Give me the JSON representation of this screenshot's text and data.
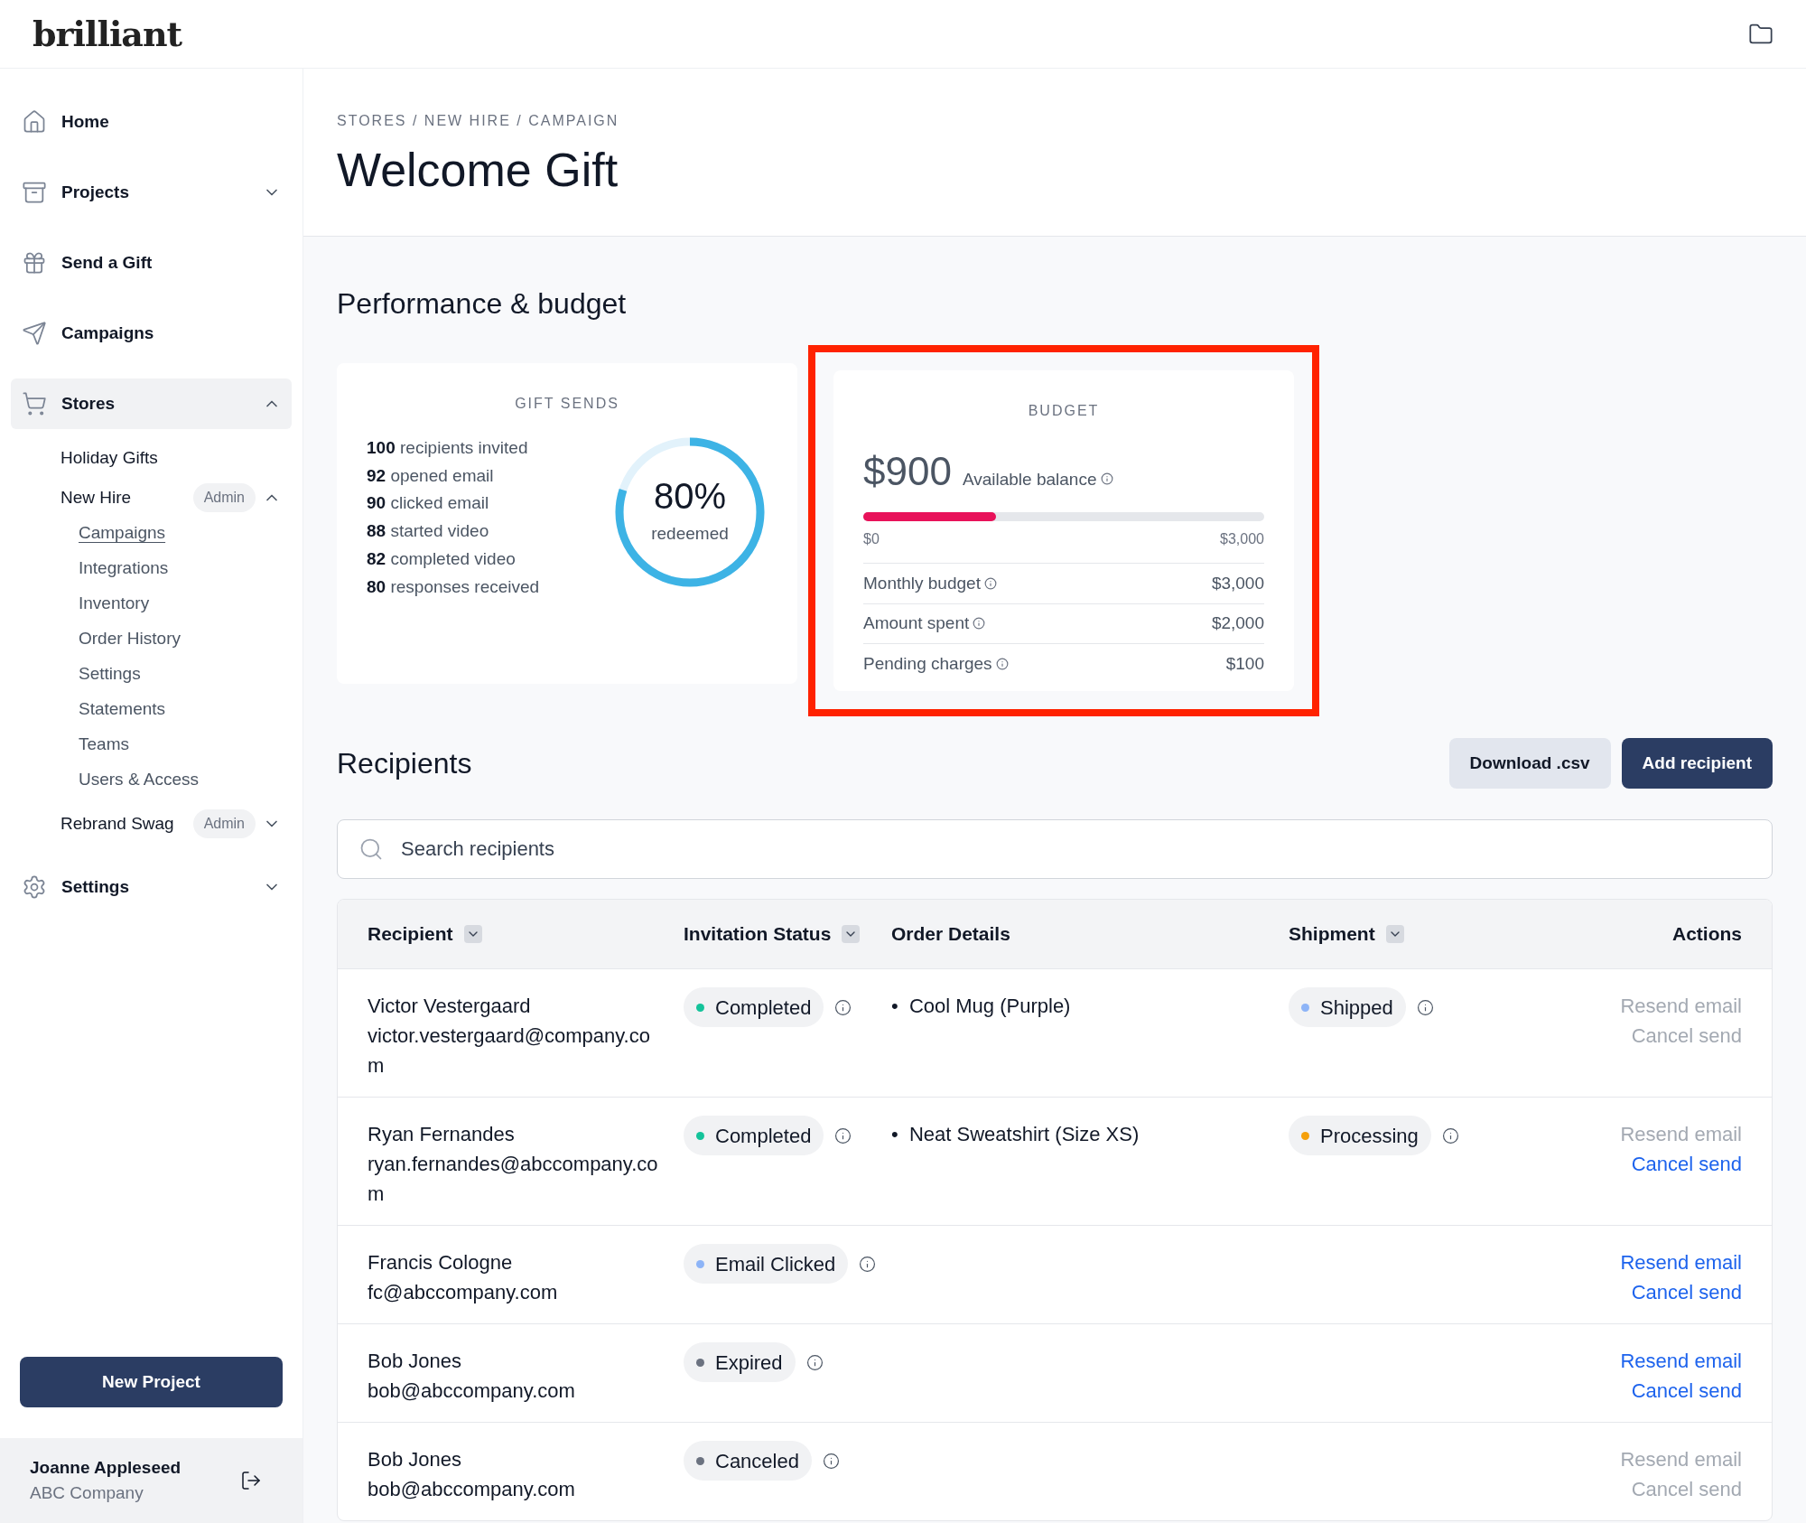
{
  "header": {
    "logo": "brilliant"
  },
  "sidebar": {
    "items": [
      {
        "label": "Home",
        "selected": false
      },
      {
        "label": "Projects",
        "selected": false,
        "expanded": false
      },
      {
        "label": "Send a Gift",
        "selected": false
      },
      {
        "label": "Campaigns",
        "selected": false
      },
      {
        "label": "Stores",
        "selected": true,
        "expanded": true,
        "children": [
          {
            "label": "Holiday Gifts"
          },
          {
            "label": "New Hire",
            "badge": "Admin",
            "expanded": true,
            "children": [
              {
                "label": "Campaigns",
                "selected": true
              },
              {
                "label": "Integrations",
                "selected": false
              },
              {
                "label": "Inventory",
                "selected": false
              },
              {
                "label": "Order History",
                "selected": false
              },
              {
                "label": "Settings",
                "selected": false
              },
              {
                "label": "Statements",
                "selected": false
              },
              {
                "label": "Teams",
                "selected": false
              },
              {
                "label": "Users & Access",
                "selected": false
              }
            ]
          },
          {
            "label": "Rebrand Swag",
            "badge": "Admin",
            "expanded": false
          }
        ]
      },
      {
        "label": "Settings",
        "selected": false,
        "expanded": false
      }
    ],
    "new_project_button": "New Project",
    "user": {
      "name": "Joanne Appleseed",
      "company": "ABC Company"
    }
  },
  "breadcrumb": "STORES / NEW HIRE / CAMPAIGN",
  "title": "Welcome Gift",
  "performance": {
    "heading": "Performance & budget",
    "gift_sends": {
      "title": "GIFT SENDS",
      "stats": [
        {
          "count": "100",
          "label": "recipients invited"
        },
        {
          "count": "92",
          "label": "opened email"
        },
        {
          "count": "90",
          "label": "clicked email"
        },
        {
          "count": "88",
          "label": "started video"
        },
        {
          "count": "82",
          "label": "completed video"
        },
        {
          "count": "80",
          "label": "responses received"
        }
      ],
      "ring": {
        "level": 0.8,
        "value": "80%",
        "caption": "redeemed"
      }
    },
    "budget": {
      "highlighted": true,
      "title": "BUDGET",
      "amount": "$900",
      "amount_label": "Available balance",
      "level": 0.33,
      "min_label": "$0",
      "max_label": "$3,000",
      "rows": [
        {
          "label": "Monthly budget",
          "value": "$3,000"
        },
        {
          "label": "Amount spent",
          "value": "$2,000"
        },
        {
          "label": "Pending charges",
          "value": "$100"
        }
      ]
    }
  },
  "recipients": {
    "heading": "Recipients",
    "buttons": [
      {
        "kind": "secondary",
        "label": "Download .csv"
      },
      {
        "kind": "primary",
        "label": "Add recipient"
      }
    ],
    "search": {
      "placeholder": "Search recipients"
    },
    "columns": [
      {
        "label": "Recipient",
        "sortable": true
      },
      {
        "label": "Invitation Status",
        "sortable": true
      },
      {
        "label": "Order Details",
        "sortable": false
      },
      {
        "label": "Shipment",
        "sortable": true
      },
      {
        "label": "Actions",
        "sortable": false
      }
    ],
    "rows": [
      {
        "name": "Victor Vestergaard",
        "email": "victor.vestergaard@company.com",
        "status": {
          "label": "Completed",
          "color": "#14c39a"
        },
        "order": [
          {
            "marker": "•",
            "text": "Cool Mug (Purple)"
          }
        ],
        "shipment": {
          "label": "Shipped",
          "color": "#8db4f7"
        },
        "actions": [
          {
            "label": "Resend email",
            "disabled": true
          },
          {
            "label": "Cancel send",
            "disabled": true
          }
        ]
      },
      {
        "name": "Ryan Fernandes",
        "email": "ryan.fernandes@abccompany.com",
        "status": {
          "label": "Completed",
          "color": "#14c39a"
        },
        "order": [
          {
            "marker": "•",
            "text": "Neat Sweatshirt (Size XS)"
          }
        ],
        "shipment": {
          "label": "Processing",
          "color": "#f5a00b"
        },
        "actions": [
          {
            "label": "Resend email",
            "disabled": true
          },
          {
            "label": "Cancel send",
            "disabled": false
          }
        ]
      },
      {
        "name": "Francis Cologne",
        "email": "fc@abccompany.com",
        "status": {
          "label": "Email Clicked",
          "color": "#8db4f7"
        },
        "actions": [
          {
            "label": "Resend email",
            "disabled": false
          },
          {
            "label": "Cancel send",
            "disabled": false
          }
        ]
      },
      {
        "name": "Bob Jones",
        "email": "bob@abccompany.com",
        "status": {
          "label": "Expired",
          "color": "#6b7280"
        },
        "actions": [
          {
            "label": "Resend email",
            "disabled": false
          },
          {
            "label": "Cancel send",
            "disabled": false
          }
        ]
      },
      {
        "name": "Bob Jones",
        "email": "bob@abccompany.com",
        "status": {
          "label": "Canceled",
          "color": "#6b7280"
        },
        "actions": [
          {
            "label": "Resend email",
            "disabled": true
          },
          {
            "label": "Cancel send",
            "disabled": true
          }
        ]
      }
    ]
  }
}
